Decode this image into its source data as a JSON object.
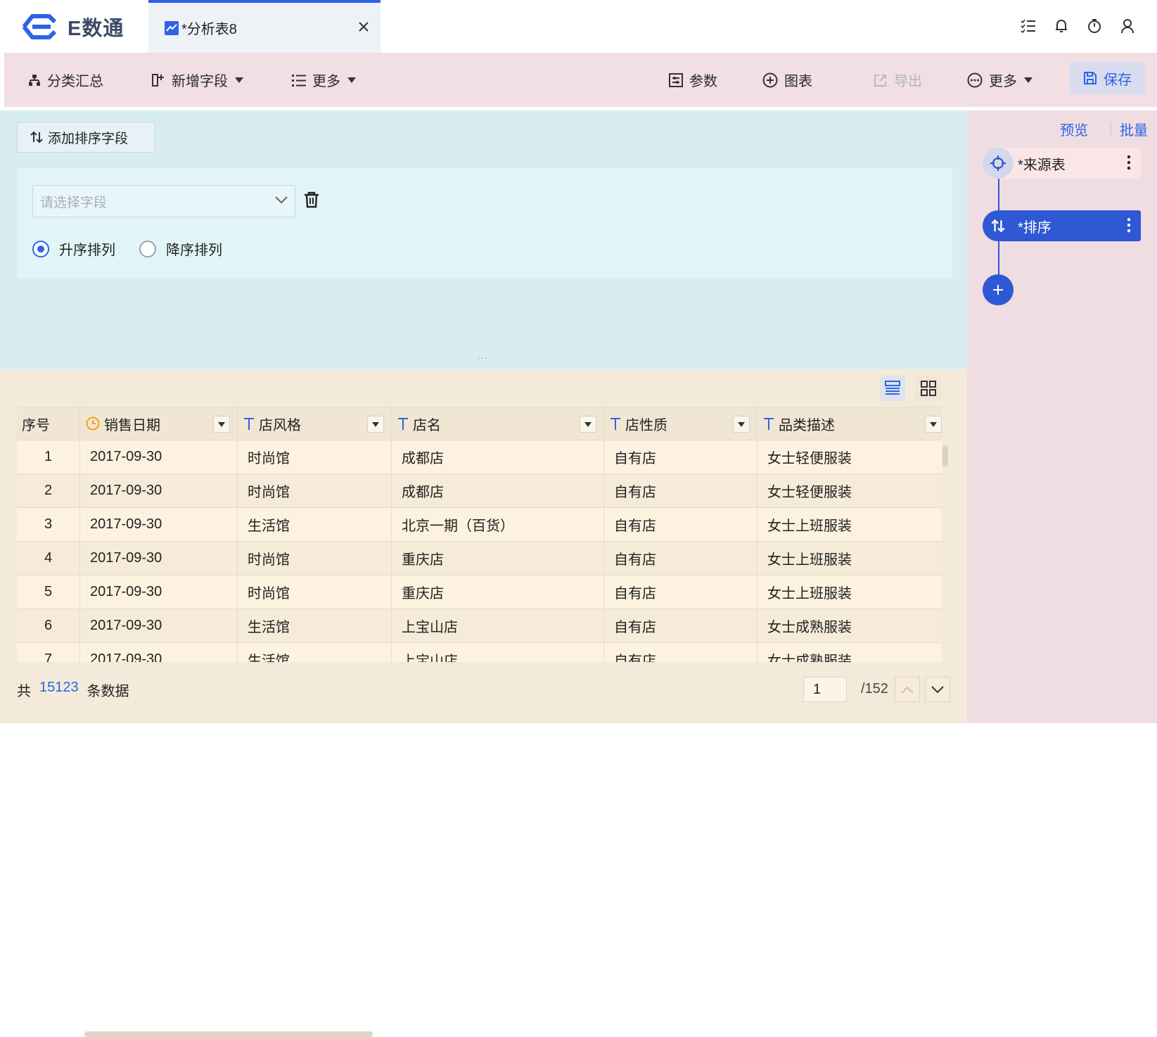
{
  "app": {
    "logo_text": "E数通"
  },
  "tab": {
    "label": "*分析表8"
  },
  "toolbar": {
    "category_summary": "分类汇总",
    "add_field": "新增字段",
    "more_left": "更多",
    "params": "参数",
    "chart": "图表",
    "export": "导出",
    "more_right": "更多",
    "save": "保存"
  },
  "config": {
    "add_sort_label": "添加排序字段",
    "field_placeholder": "请选择字段",
    "ascending_label": "升序排列",
    "descending_label": "降序排列",
    "sort_order": "ascending",
    "splitter": "..."
  },
  "table": {
    "columns": [
      {
        "label": "序号",
        "type": ""
      },
      {
        "label": "销售日期",
        "type": "date"
      },
      {
        "label": "店风格",
        "type": "text"
      },
      {
        "label": "店名",
        "type": "text"
      },
      {
        "label": "店性质",
        "type": "text"
      },
      {
        "label": "品类描述",
        "type": "text"
      }
    ],
    "rows": [
      [
        "1",
        "2017-09-30",
        "时尚馆",
        "成都店",
        "自有店",
        "女士轻便服装"
      ],
      [
        "2",
        "2017-09-30",
        "时尚馆",
        "成都店",
        "自有店",
        "女士轻便服装"
      ],
      [
        "3",
        "2017-09-30",
        "生活馆",
        "北京一期（百货）",
        "自有店",
        "女士上班服装"
      ],
      [
        "4",
        "2017-09-30",
        "时尚馆",
        "重庆店",
        "自有店",
        "女士上班服装"
      ],
      [
        "5",
        "2017-09-30",
        "时尚馆",
        "重庆店",
        "自有店",
        "女士上班服装"
      ],
      [
        "6",
        "2017-09-30",
        "生活馆",
        "上宝山店",
        "自有店",
        "女士成熟服装"
      ],
      [
        "7",
        "2017-09-30",
        "生活馆",
        "上宝山店",
        "自有店",
        "女士成熟服装"
      ]
    ]
  },
  "footer": {
    "prefix": "共",
    "total": "15123",
    "suffix": "条数据",
    "page": "1",
    "page_total": "/152"
  },
  "right_panel": {
    "preview": "预览",
    "batch": "批量",
    "nodes": [
      {
        "label": "*来源表",
        "icon": "target-icon"
      },
      {
        "label": "*排序",
        "icon": "sort-icon"
      }
    ]
  },
  "colors": {
    "accent": "#2d63e8",
    "node_active": "#2e58d4"
  }
}
